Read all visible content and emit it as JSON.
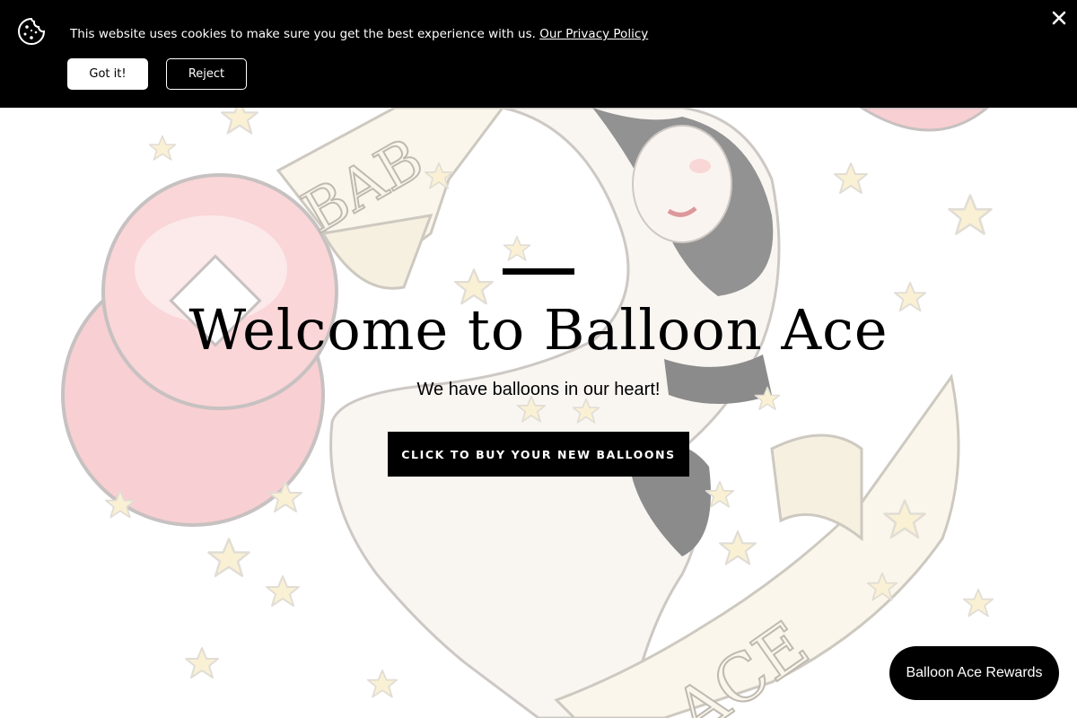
{
  "cookie_banner": {
    "message": "This website uses cookies to make sure you get the best experience with us.",
    "privacy_link": "Our Privacy Policy",
    "accept_label": "Got it!",
    "reject_label": "Reject",
    "close_icon": "close-icon",
    "cookie_icon": "cookie-icon",
    "background_color": "#000000"
  },
  "hero": {
    "title": "Welcome to Balloon Ace",
    "subtitle": "We have balloons in our heart!",
    "cta_label": "CLICK TO BUY YOUR NEW BALLOONS",
    "background_image": "faded pin-up girl with balloons, stars and banner illustration"
  },
  "background_art": {
    "banner_text_top": "BAB",
    "banner_text_bottom": "ACE"
  },
  "rewards": {
    "label": "Balloon Ace Rewards"
  },
  "colors": {
    "primary": "#000000",
    "background": "#ffffff",
    "balloon_red": "#f4a9ae",
    "star_yellow": "#f6e6b4",
    "banner_cream": "#f7f0dc"
  }
}
